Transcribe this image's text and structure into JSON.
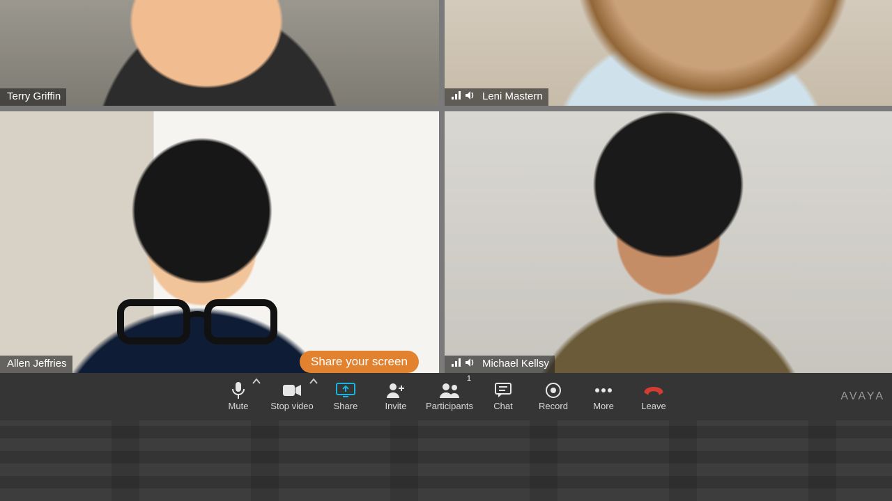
{
  "participants": [
    {
      "name": "Terry Griffin",
      "show_signal": false,
      "show_audio": false
    },
    {
      "name": "Leni Mastern",
      "show_signal": true,
      "show_audio": true
    },
    {
      "name": "Allen Jeffries",
      "show_signal": false,
      "show_audio": false
    },
    {
      "name": "Michael Kellsy",
      "show_signal": true,
      "show_audio": true
    }
  ],
  "tooltip": {
    "text": "Share your screen"
  },
  "toolbar": {
    "mute": {
      "label": "Mute",
      "has_chevron": true
    },
    "stop_video": {
      "label": "Stop video",
      "has_chevron": true
    },
    "share": {
      "label": "Share"
    },
    "invite": {
      "label": "Invite"
    },
    "participants": {
      "label": "Participants",
      "badge": "1"
    },
    "chat": {
      "label": "Chat"
    },
    "record": {
      "label": "Record"
    },
    "more": {
      "label": "More"
    },
    "leave": {
      "label": "Leave"
    }
  },
  "brand": "AVAYA"
}
